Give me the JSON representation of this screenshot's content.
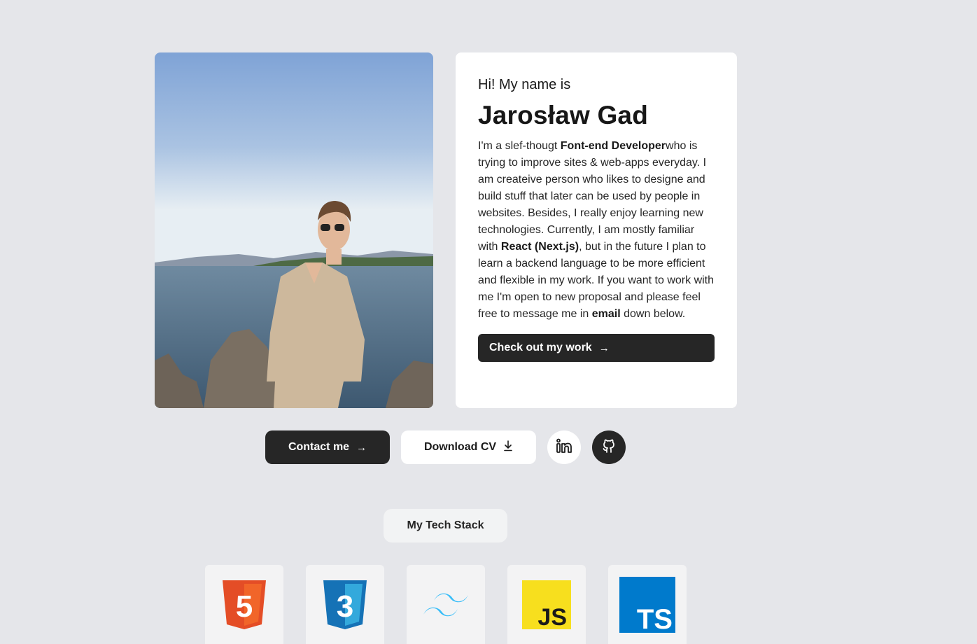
{
  "profile": {
    "greeting": "Hi! My name is",
    "name": "Jarosław Gad",
    "bio": [
      {
        "text": "I'm a slef-thougt "
      },
      {
        "text": "Font-end Developer",
        "bold": true
      },
      {
        "text": "who is trying to improve sites & web-apps everyday. I am createive person who likes to designe and build stuff that later can be used by people in websites. Besides, I really enjoy learning new technologies. Currently, I am mostly familiar with "
      },
      {
        "text": "React (Next.js)",
        "bold": true
      },
      {
        "text": ", but in the future I plan to learn a backend language to be more efficient and flexible in my work. If you want to work with me I'm open to new proposal and please feel free to message me in "
      },
      {
        "text": "email",
        "bold": true
      },
      {
        "text": " down below."
      }
    ],
    "work_button": "Check out my work"
  },
  "actions": {
    "contact_label": "Contact me",
    "cv_label": "Download CV"
  },
  "tech_stack": {
    "label": "My Tech Stack",
    "items": [
      {
        "icon": "html5-icon",
        "text": "5"
      },
      {
        "icon": "css3-icon",
        "text": "3"
      },
      {
        "icon": "tailwind-icon",
        "text": ""
      },
      {
        "icon": "javascript-icon",
        "text": "JS"
      },
      {
        "icon": "typescript-icon",
        "text": "TS"
      }
    ]
  },
  "colors": {
    "page_bg": "#e5e6ea",
    "dark": "#262626",
    "html": "#e44d26",
    "css": "#1572b6",
    "tailwind": "#38bdf8",
    "js": "#f7df1e",
    "ts": "#007acc"
  },
  "icons": {
    "arrow": "→",
    "download": "download-icon"
  }
}
